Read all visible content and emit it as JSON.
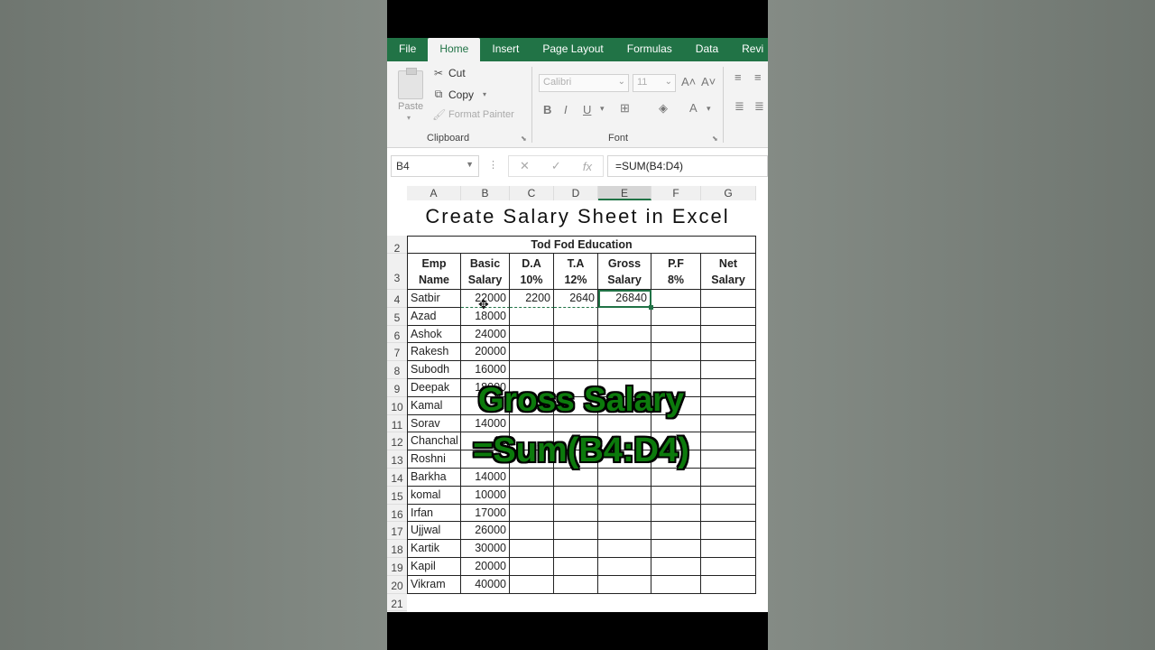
{
  "ribbon": {
    "tabs": [
      "File",
      "Home",
      "Insert",
      "Page Layout",
      "Formulas",
      "Data",
      "Revi"
    ],
    "active_tab": "Home",
    "clipboard": {
      "paste": "Paste",
      "cut": "Cut",
      "copy": "Copy",
      "format_painter": "Format Painter",
      "label": "Clipboard"
    },
    "font": {
      "name": "Calibri",
      "size": "11",
      "label": "Font",
      "bold": "B",
      "italic": "I",
      "underline": "U"
    }
  },
  "formula_bar": {
    "name_box": "B4",
    "formula": "=SUM(B4:D4)"
  },
  "banner": "Create Salary Sheet in Excel",
  "columns": [
    "A",
    "B",
    "C",
    "D",
    "E",
    "F",
    "G"
  ],
  "sheet": {
    "title": "Tod Fod Education",
    "headers": [
      {
        "top": "Emp",
        "bottom": "Name"
      },
      {
        "top": "Basic",
        "bottom": "Salary"
      },
      {
        "top": "D.A",
        "bottom": "10%"
      },
      {
        "top": "T.A",
        "bottom": "12%"
      },
      {
        "top": "Gross",
        "bottom": "Salary"
      },
      {
        "top": "P.F",
        "bottom": "8%"
      },
      {
        "top": "Net",
        "bottom": "Salary"
      }
    ],
    "first_row": {
      "da": "2200",
      "ta": "2640",
      "gross": "26840"
    },
    "rows": [
      {
        "n": "4",
        "name": "Satbir",
        "basic": "22000"
      },
      {
        "n": "5",
        "name": "Azad",
        "basic": "18000"
      },
      {
        "n": "6",
        "name": "Ashok",
        "basic": "24000"
      },
      {
        "n": "7",
        "name": "Rakesh",
        "basic": "20000"
      },
      {
        "n": "8",
        "name": "Subodh",
        "basic": "16000"
      },
      {
        "n": "9",
        "name": "Deepak",
        "basic": "18000"
      },
      {
        "n": "10",
        "name": "Kamal",
        "basic": ""
      },
      {
        "n": "11",
        "name": "Sorav",
        "basic": "14000"
      },
      {
        "n": "12",
        "name": "Chanchal",
        "basic": "12"
      },
      {
        "n": "13",
        "name": "Roshni",
        "basic": ""
      },
      {
        "n": "14",
        "name": "Barkha",
        "basic": "14000"
      },
      {
        "n": "15",
        "name": "komal",
        "basic": "10000"
      },
      {
        "n": "16",
        "name": "Irfan",
        "basic": "17000"
      },
      {
        "n": "17",
        "name": "Ujjwal",
        "basic": "26000"
      },
      {
        "n": "18",
        "name": "Kartik",
        "basic": "30000"
      },
      {
        "n": "19",
        "name": "Kapil",
        "basic": "20000"
      },
      {
        "n": "20",
        "name": "Vikram",
        "basic": "40000"
      }
    ],
    "row_numbers_top": [
      "2",
      "3"
    ],
    "last_row_number": "21"
  },
  "overlay": {
    "line1": "Gross Salary",
    "line2": "=Sum(B4:D4)"
  },
  "colors": {
    "excel_green": "#217346",
    "overlay_green": "#0c7a0c"
  }
}
